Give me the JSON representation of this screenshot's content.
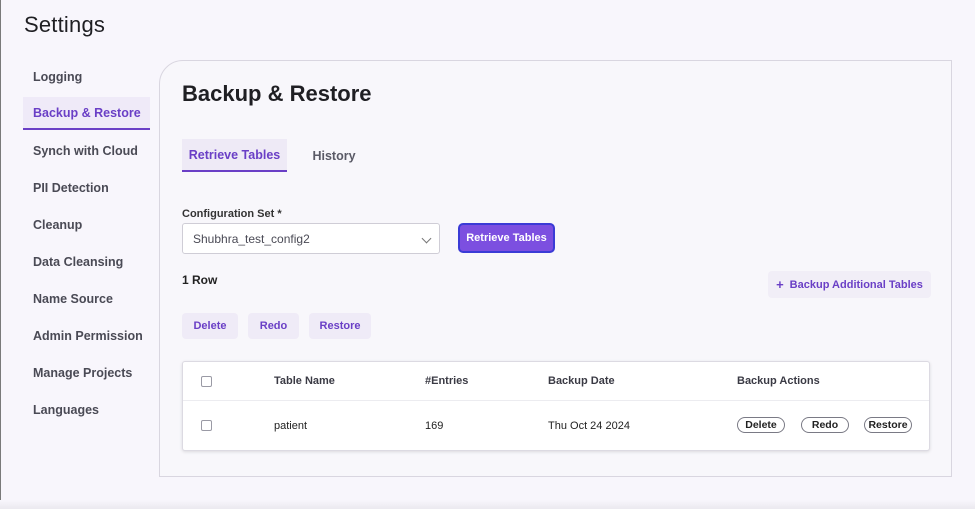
{
  "page_title": "Settings",
  "sidebar": {
    "items": [
      {
        "label": "Logging"
      },
      {
        "label": "Backup & Restore",
        "active": true
      },
      {
        "label": "Synch with Cloud"
      },
      {
        "label": "PII Detection"
      },
      {
        "label": "Cleanup"
      },
      {
        "label": "Data Cleansing"
      },
      {
        "label": "Name Source"
      },
      {
        "label": "Admin Permission"
      },
      {
        "label": "Manage Projects"
      },
      {
        "label": "Languages"
      }
    ]
  },
  "main": {
    "title": "Backup & Restore",
    "tabs": [
      {
        "label": "Retrieve Tables",
        "active": true
      },
      {
        "label": "History"
      }
    ],
    "config_label": "Configuration Set *",
    "config_value": "Shubhra_test_config2",
    "retrieve_button": "Retrieve Tables",
    "row_count": "1 Row",
    "add_button": "Backup Additional Tables",
    "add_icon": "+",
    "actions": [
      "Delete",
      "Redo",
      "Restore"
    ],
    "table": {
      "headers": [
        "Table Name",
        "#Entries",
        "Backup Date",
        "Backup Actions"
      ],
      "rows": [
        {
          "table_name": "patient",
          "entries": "169",
          "backup_date": "Thu Oct 24 2024",
          "row_actions": [
            "Delete",
            "Redo",
            "Restore"
          ]
        }
      ]
    }
  },
  "colors": {
    "accent": "#6a3fc6",
    "primary_button": "#7c4fe0",
    "background": "#f8f6fc"
  }
}
